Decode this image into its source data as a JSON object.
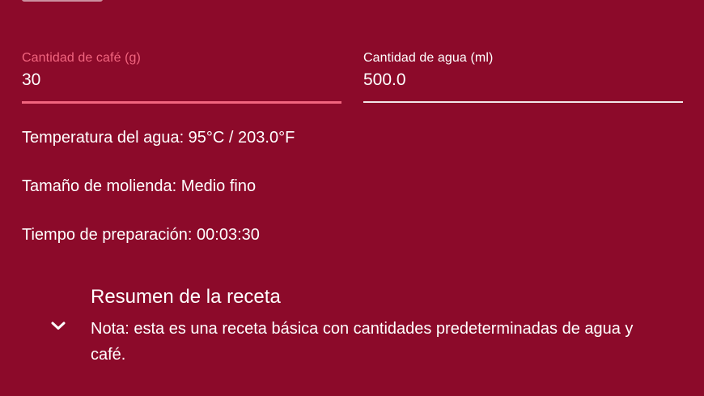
{
  "colors": {
    "background": "#8c0a2a",
    "accent": "#f2657f",
    "text": "#ffffff"
  },
  "coffee_field": {
    "label": "Cantidad de café (g)",
    "value": "30"
  },
  "water_field": {
    "label": "Cantidad de agua (ml)",
    "value": "500.0"
  },
  "info": {
    "temperature": "Temperatura del agua: 95°C / 203.0°F",
    "grind": "Tamaño de molienda: Medio fino",
    "time": "Tiempo de preparación: 00:03:30"
  },
  "summary": {
    "title": "Resumen de la receta",
    "note": "Nota: esta es una receta básica con cantidades predeterminadas de agua y café.",
    "icon": "chevron-down-icon"
  }
}
